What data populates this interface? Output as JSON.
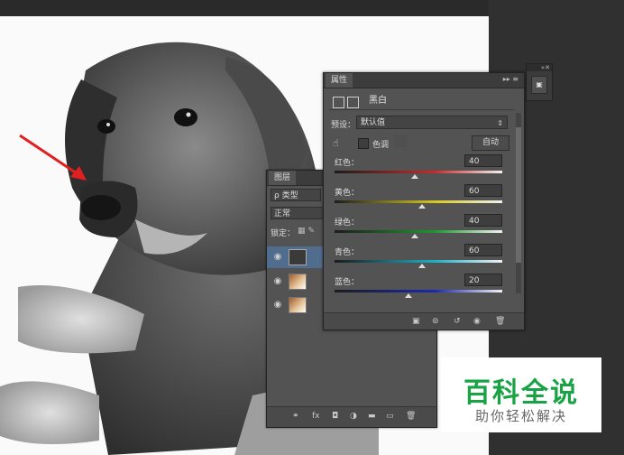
{
  "properties_panel": {
    "tab": "属性",
    "title": "黑白",
    "preset_label": "预设：",
    "preset_value": "默认值",
    "tint_label": "色调",
    "auto_label": "自动",
    "sliders": [
      {
        "label": "红色：",
        "value": "40",
        "level": 40,
        "color": "#cc2a2a"
      },
      {
        "label": "黄色：",
        "value": "60",
        "level": 60,
        "color": "#d8c81a"
      },
      {
        "label": "绿色：",
        "value": "40",
        "level": 40,
        "color": "#1a9a2a"
      },
      {
        "label": "青色：",
        "value": "60",
        "level": 60,
        "color": "#1ab0c8"
      },
      {
        "label": "蓝色：",
        "value": "20",
        "level": 20,
        "color": "#1a2ab0"
      }
    ]
  },
  "layers_panel": {
    "tab": "图层",
    "filter": "ρ 类型",
    "blend": "正常",
    "lock_label": "锁定："
  },
  "watermark": {
    "title": "百科全说",
    "subtitle": "助你轻松解决"
  }
}
